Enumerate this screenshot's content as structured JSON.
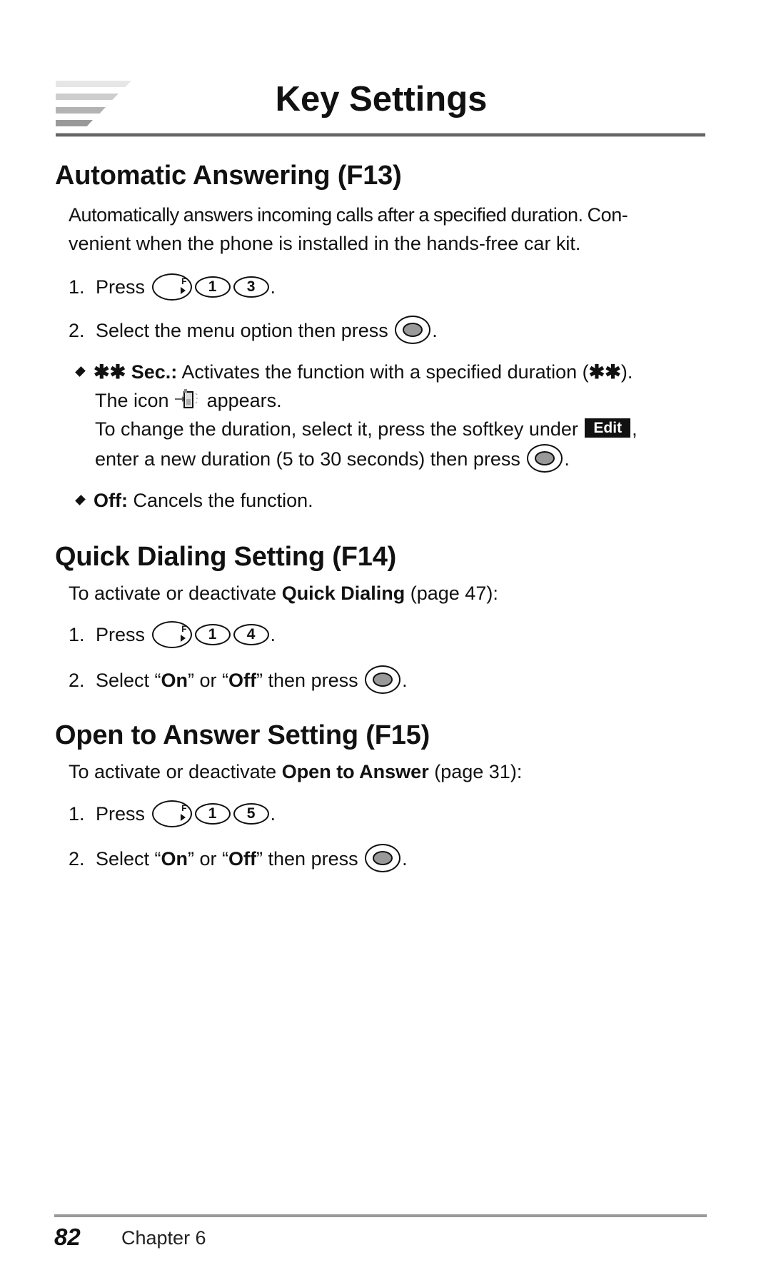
{
  "header": {
    "title": "Key Settings"
  },
  "sections": [
    {
      "heading": "Automatic Answering (F13)",
      "intro_line1": "Automatically answers incoming calls after a specified duration. Con-",
      "intro_line2": "venient when the phone is installed in the hands-free car kit.",
      "step1": {
        "num": "1.",
        "label": "Press",
        "keys": [
          "F",
          "1",
          "3"
        ],
        "end": "."
      },
      "step2": {
        "num": "2.",
        "label": "Select the menu option then press",
        "key": "ok-key",
        "end": "."
      },
      "options": [
        {
          "star_label": "✱✱",
          "name": "Sec.:",
          "line1": "Activates the function with a specified duration (",
          "line1_star": "✱✱",
          "line1_end": ").",
          "line2_pre": "The icon",
          "line2_icon": "auto-answer-indicator-icon",
          "line2_post": "appears.",
          "line3_pre": "To change the duration, select it, press the softkey under",
          "softkey": "Edit",
          "line3_post": ",",
          "line4": "enter a new duration (5 to 30 seconds) then press",
          "line4_end": "."
        },
        {
          "name": "Off:",
          "text": "Cancels the function."
        }
      ]
    },
    {
      "heading": "Quick Dialing Setting (F14)",
      "intro_pre": "To activate or deactivate",
      "intro_bold": "Quick Dialing",
      "intro_post": "(page 47):",
      "step1": {
        "num": "1.",
        "label": "Press",
        "keys": [
          "F",
          "1",
          "4"
        ],
        "end": "."
      },
      "step2": {
        "num": "2.",
        "pre": "Select “",
        "on": "On",
        "mid": "” or “",
        "off": "Off",
        "post": "” then press",
        "end": "."
      }
    },
    {
      "heading": "Open to Answer Setting (F15)",
      "intro_pre": "To activate or deactivate",
      "intro_bold": "Open to Answer",
      "intro_post": "(page 31):",
      "step1": {
        "num": "1.",
        "label": "Press",
        "keys": [
          "F",
          "1",
          "5"
        ],
        "end": "."
      },
      "step2": {
        "num": "2.",
        "pre": "Select “",
        "on": "On",
        "mid": "” or “",
        "off": "Off",
        "post": "” then press",
        "end": "."
      }
    }
  ],
  "footer": {
    "page_number": "82",
    "chapter": "Chapter 6"
  }
}
